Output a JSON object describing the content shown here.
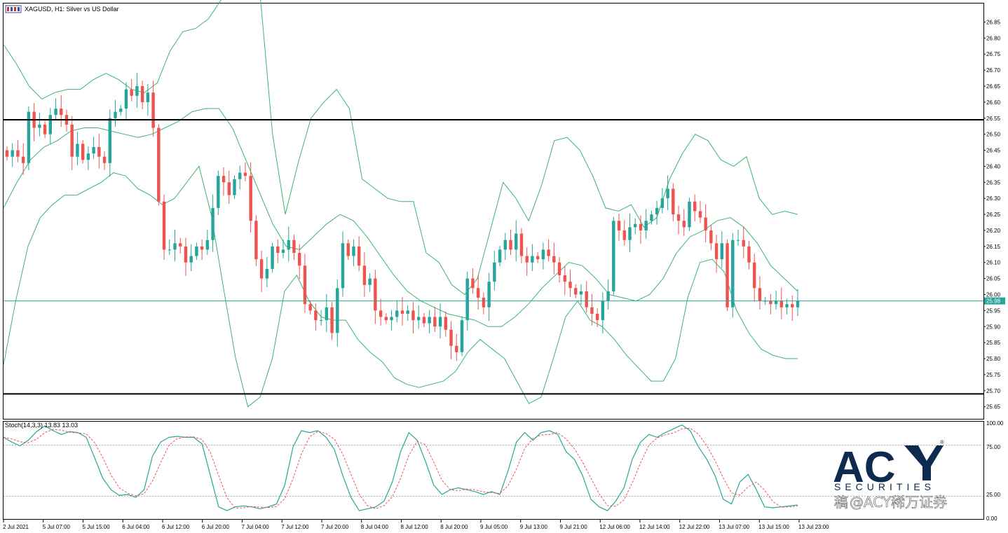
{
  "chart_data": {
    "type": "candlestick",
    "symbol": "XAGUSD",
    "timeframe": "H1",
    "title": "XAGUSD, H1:  Silver vs US Dollar",
    "ylim": [
      25.61,
      26.91
    ],
    "price_ticks": [
      "26.85",
      "26.80",
      "26.75",
      "26.70",
      "26.65",
      "26.60",
      "26.55",
      "26.50",
      "26.45",
      "26.40",
      "26.35",
      "26.30",
      "26.25",
      "26.20",
      "26.15",
      "26.10",
      "26.05",
      "26.00",
      "25.95",
      "25.90",
      "25.85",
      "25.80",
      "25.75",
      "25.70",
      "25.65"
    ],
    "time_labels": [
      "2 Jul 2021",
      "5 Jul 07:00",
      "5 Jul 15:00",
      "6 Jul 04:00",
      "6 Jul 12:00",
      "6 Jul 20:00",
      "7 Jul 04:00",
      "7 Jul 12:00",
      "7 Jul 20:00",
      "8 Jul 04:00",
      "8 Jul 12:00",
      "8 Jul 20:00",
      "9 Jul 05:00",
      "9 Jul 13:00",
      "9 Jul 21:00",
      "12 Jul 06:00",
      "12 Jul 14:00",
      "12 Jul 22:00",
      "13 Jul 07:00",
      "13 Jul 15:00",
      "13 Jul 23:00"
    ],
    "current_price": "25.98",
    "horizontal_levels": [
      26.545,
      25.69
    ],
    "bull_color": "#26a69a",
    "bear_color": "#ef5350",
    "band_color": "#3cb371",
    "close_path": [
      26.43,
      26.45,
      26.43,
      26.41,
      26.57,
      26.52,
      26.53,
      26.5,
      26.56,
      26.58,
      26.56,
      26.53,
      26.43,
      26.47,
      26.42,
      26.44,
      26.46,
      26.43,
      26.41,
      26.55,
      26.57,
      26.58,
      26.64,
      26.62,
      26.65,
      26.6,
      26.63,
      26.52,
      26.29,
      26.14,
      26.14,
      26.16,
      26.15,
      26.1,
      26.12,
      26.15,
      26.14,
      26.17,
      26.27,
      26.37,
      26.35,
      26.31,
      26.36,
      26.38,
      26.37,
      26.23,
      26.11,
      26.05,
      26.08,
      26.15,
      26.13,
      26.14,
      26.17,
      26.13,
      26.09,
      25.97,
      25.95,
      25.92,
      25.92,
      25.96,
      25.88,
      26.02,
      26.16,
      26.12,
      26.15,
      26.09,
      26.03,
      26.05,
      25.95,
      25.93,
      25.92,
      25.93,
      25.95,
      25.94,
      25.95,
      25.92,
      25.93,
      25.91,
      25.93,
      25.9,
      25.93,
      25.89,
      25.84,
      25.82,
      25.92,
      26.05,
      26.02,
      25.99,
      25.96,
      26.04,
      26.1,
      26.14,
      26.17,
      26.14,
      26.19,
      26.12,
      26.1,
      26.12,
      26.11,
      26.14,
      26.12,
      26.1,
      26.06,
      26.04,
      26.02,
      26.0,
      26.01,
      25.96,
      25.94,
      25.92,
      25.98,
      26.01,
      26.23,
      26.2,
      26.17,
      26.21,
      26.22,
      26.2,
      26.23,
      26.25,
      26.27,
      26.3,
      26.33,
      26.25,
      26.23,
      26.21,
      26.29,
      26.26,
      26.24,
      26.2,
      26.16,
      26.11,
      26.16,
      25.96,
      26.17,
      26.17,
      26.15,
      26.1,
      26.02,
      25.98,
      25.98,
      25.97,
      25.98,
      25.96,
      25.97,
      25.96,
      25.98
    ],
    "bollinger": {
      "period_label": "",
      "upper": [
        26.78,
        26.72,
        26.65,
        26.61,
        26.63,
        26.64,
        26.64,
        26.67,
        26.69,
        26.67,
        26.64,
        26.63,
        26.66,
        26.76,
        26.82,
        26.83,
        26.86,
        26.92,
        27.1,
        27.3,
        26.95,
        26.5,
        26.25,
        26.41,
        26.55,
        26.6,
        26.64,
        26.58,
        26.36,
        26.33,
        26.3,
        26.29,
        26.29,
        26.13,
        26.1,
        26.03,
        26.0,
        26.05,
        26.2,
        26.35,
        26.3,
        26.23,
        26.34,
        26.48,
        26.49,
        26.45,
        26.37,
        26.27,
        26.26,
        26.28,
        26.21,
        26.24,
        26.36,
        26.44,
        26.5,
        26.48,
        26.42,
        26.4,
        26.43,
        26.3,
        26.25,
        26.26,
        26.25
      ],
      "middle": [
        26.27,
        26.35,
        26.42,
        26.46,
        26.48,
        26.51,
        26.52,
        26.52,
        26.51,
        26.5,
        26.49,
        26.5,
        26.52,
        26.54,
        26.57,
        26.58,
        26.58,
        26.52,
        26.42,
        26.32,
        26.22,
        26.15,
        26.14,
        26.18,
        26.22,
        26.25,
        26.23,
        26.18,
        26.12,
        26.06,
        26.01,
        25.98,
        25.96,
        25.94,
        25.93,
        25.92,
        25.9,
        25.9,
        25.93,
        25.97,
        26.02,
        26.06,
        26.1,
        26.09,
        26.05,
        26.0,
        25.99,
        25.98,
        26.0,
        26.05,
        26.13,
        26.18,
        26.2,
        26.23,
        26.24,
        26.21,
        26.16,
        26.09,
        26.05,
        26.01
      ],
      "lower": [
        25.78,
        25.98,
        26.15,
        26.24,
        26.28,
        26.31,
        26.31,
        26.33,
        26.35,
        26.38,
        26.37,
        26.33,
        26.31,
        26.28,
        26.3,
        26.35,
        26.4,
        26.25,
        26.02,
        25.8,
        25.65,
        25.68,
        25.8,
        26.01,
        26.06,
        25.98,
        25.93,
        25.92,
        25.92,
        25.86,
        25.82,
        25.79,
        25.74,
        25.72,
        25.71,
        25.72,
        25.73,
        25.76,
        25.82,
        25.86,
        25.83,
        25.8,
        25.73,
        25.66,
        25.68,
        25.8,
        25.93,
        25.98,
        25.92,
        25.9,
        25.86,
        25.81,
        25.77,
        25.73,
        25.73,
        25.8,
        25.99,
        26.1,
        26.11,
        26.07,
        25.95,
        25.88,
        25.83,
        25.81,
        25.8,
        25.8
      ],
      "upper_end": 26.24
    },
    "stochastic": {
      "title": "Stoch(14,3,3) 13.83 13.03",
      "ylim": [
        0,
        100
      ],
      "ticks": [
        "100.00",
        "75.00",
        "25.00",
        "0.00"
      ],
      "levels": [
        80,
        20
      ],
      "main_color": "#26a69a",
      "signal_color": "#ef5350",
      "main": [
        85,
        80,
        76,
        82,
        91,
        97,
        92,
        88,
        91,
        90,
        85,
        64,
        42,
        30,
        24,
        25,
        22,
        30,
        65,
        80,
        85,
        86,
        85,
        85,
        78,
        45,
        12,
        8,
        12,
        13,
        12,
        10,
        12,
        15,
        35,
        75,
        92,
        90,
        92,
        85,
        72,
        45,
        22,
        8,
        10,
        12,
        18,
        38,
        70,
        90,
        82,
        60,
        35,
        25,
        30,
        32,
        30,
        28,
        25,
        28,
        25,
        50,
        80,
        90,
        82,
        90,
        92,
        88,
        70,
        62,
        45,
        20,
        12,
        8,
        18,
        32,
        62,
        80,
        88,
        85,
        90,
        94,
        98,
        92,
        75,
        62,
        45,
        20,
        15,
        38,
        46,
        30,
        12,
        11,
        12,
        13,
        14
      ]
    }
  }
}
